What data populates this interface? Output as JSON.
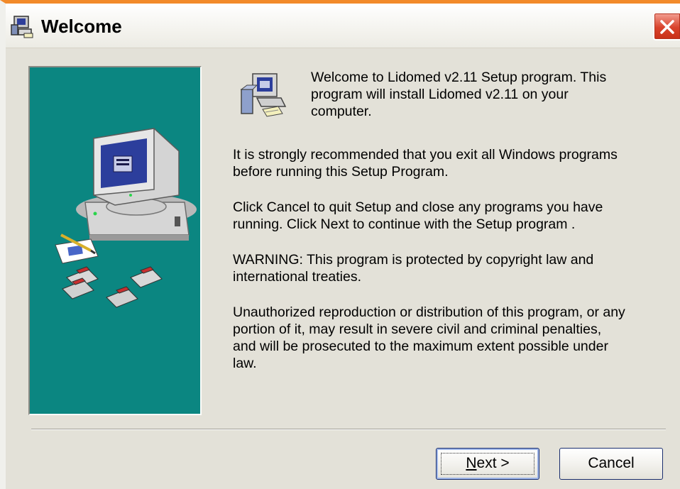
{
  "window": {
    "title": "Welcome",
    "icon": "setup-program-icon"
  },
  "controls": {
    "close_icon": "close-x-icon"
  },
  "content": {
    "intro": "Welcome to Lidomed  v2.11 Setup program. This\nprogram will install Lidomed  v2.11 on your\ncomputer.",
    "para1": "It is strongly recommended that you exit all Windows programs\nbefore running this Setup Program.",
    "para2": "Click Cancel to quit Setup and close any programs you have\nrunning.  Click Next to continue with the Setup program .",
    "para3": "WARNING: This program is protected by copyright law and\ninternational treaties.",
    "para4": "Unauthorized reproduction or distribution of this program, or any\nportion of it, may result in severe civil and criminal penalties,\nand will be prosecuted to the maximum extent possible under\nlaw."
  },
  "buttons": {
    "next_mnemonic": "N",
    "next_rest": "ext >",
    "cancel": "Cancel"
  },
  "colors": {
    "side_panel": "#0b8681",
    "dialog_bg": "#e3e1d8",
    "close_button": "#d9432c",
    "outer_frame": "#e07a26"
  }
}
